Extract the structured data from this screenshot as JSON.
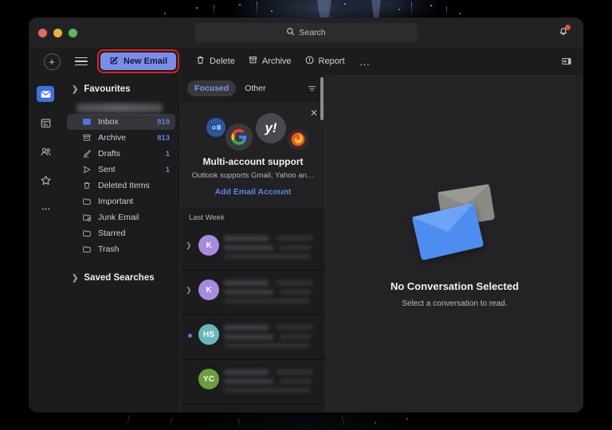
{
  "window": {
    "traffic_lights": [
      "close",
      "minimize",
      "zoom"
    ],
    "accent": "#7a8ee8",
    "highlight_border": "#e01f1f"
  },
  "search": {
    "placeholder": "Search",
    "value": "",
    "icon": "search-icon"
  },
  "notifications": {
    "icon": "bell-icon",
    "has_badge": true,
    "badge_color": "#e0503e"
  },
  "toolbar": {
    "add_label": "+",
    "menu_icon": "hamburger-icon",
    "new_email_label": "New Email",
    "new_email_icon": "compose-icon",
    "delete_label": "Delete",
    "delete_icon": "trash-icon",
    "archive_label": "Archive",
    "archive_icon": "archive-box-icon",
    "report_label": "Report",
    "report_icon": "report-exclamation-icon",
    "overflow_label": "…",
    "pane_toggle_icon": "reading-pane-toggle-icon"
  },
  "rail": {
    "items": [
      {
        "name": "mail",
        "icon": "mail-icon",
        "active": true
      },
      {
        "name": "calendar",
        "icon": "calendar-icon",
        "active": false
      },
      {
        "name": "people",
        "icon": "people-icon",
        "active": false
      },
      {
        "name": "favorites",
        "icon": "star-icon",
        "active": false
      },
      {
        "name": "more",
        "icon": "ellipsis-icon",
        "active": false
      }
    ]
  },
  "sidebar": {
    "favourites_label": "Favourites",
    "account_label": "",
    "saved_searches_label": "Saved Searches",
    "folders": [
      {
        "label": "Inbox",
        "count": "919",
        "icon": "inbox-icon",
        "selected": true
      },
      {
        "label": "Archive",
        "count": "813",
        "icon": "archive-icon",
        "selected": false
      },
      {
        "label": "Drafts",
        "count": "1",
        "icon": "drafts-icon",
        "selected": false
      },
      {
        "label": "Sent",
        "count": "1",
        "icon": "sent-icon",
        "selected": false
      },
      {
        "label": "Deleted Items",
        "count": "",
        "icon": "trash-icon",
        "selected": false
      },
      {
        "label": "Important",
        "count": "",
        "icon": "folder-icon",
        "selected": false
      },
      {
        "label": "Junk Email",
        "count": "",
        "icon": "junk-icon",
        "selected": false
      },
      {
        "label": "Starred",
        "count": "",
        "icon": "folder-icon",
        "selected": false
      },
      {
        "label": "Trash",
        "count": "",
        "icon": "folder-icon",
        "selected": false
      }
    ]
  },
  "message_list": {
    "tabs": [
      {
        "label": "Focused",
        "active": true
      },
      {
        "label": "Other",
        "active": false
      }
    ],
    "filter_icon": "filter-icon",
    "promo": {
      "close_icon": "close-icon",
      "title": "Multi-account support",
      "subtitle": "Outlook supports Gmail, Yahoo an…",
      "link_label": "Add Email Account",
      "logos": [
        {
          "name": "outlook-logo",
          "glyph": "O",
          "bg": "#2b5797"
        },
        {
          "name": "google-logo",
          "glyph": "G",
          "bg": "#3a3a3e"
        },
        {
          "name": "yahoo-logo",
          "glyph": "y!",
          "bg": "#4a4a4e"
        },
        {
          "name": "firefox-logo",
          "glyph": "🦊",
          "bg": "#3a2b22"
        }
      ]
    },
    "group_header": "Last Week",
    "rows": [
      {
        "initials": "K",
        "avatar_color": "#a78bdc",
        "unread": false,
        "has_thread_chevron": true,
        "redacted": true
      },
      {
        "initials": "K",
        "avatar_color": "#a78bdc",
        "unread": false,
        "has_thread_chevron": true,
        "redacted": true
      },
      {
        "initials": "HS",
        "avatar_color": "#6bb8bc",
        "unread": true,
        "has_thread_chevron": false,
        "redacted": true
      },
      {
        "initials": "YC",
        "avatar_color": "#6a9e3f",
        "unread": false,
        "has_thread_chevron": false,
        "redacted": true
      }
    ]
  },
  "reading_pane": {
    "title": "No Conversation Selected",
    "subtitle": "Select a conversation to read.",
    "illustration": "two-envelopes-illustration"
  }
}
